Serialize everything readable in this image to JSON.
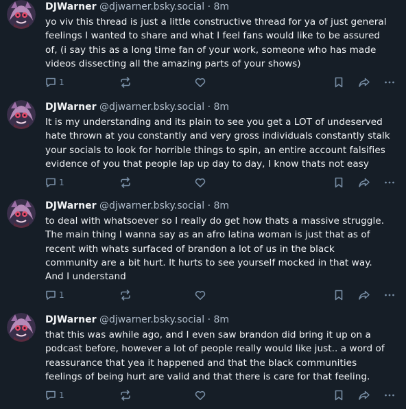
{
  "posts": [
    {
      "author_name": "DJWarner",
      "handle": "@djwarner.bsky.social",
      "time": "· 8m",
      "lines": [
        "yo viv this thread is just a little constructive thread for ya of just general",
        "feelings I wanted to share and what I feel fans would like to be assured",
        "of, (i say this as a long time fan of your work, someone who has made",
        "videos dissecting all the amazing parts of your shows)"
      ],
      "reply_count": "1"
    },
    {
      "author_name": "DJWarner",
      "handle": "@djwarner.bsky.social",
      "time": "· 8m",
      "lines": [
        "It is my understanding and its plain to see you get a LOT of undeserved",
        "hate thrown at you constantly and very gross individuals constantly stalk",
        "your socials to look for horrible things to spin, an entire account falsifies",
        "evidence of you that people lap up day to day, I know thats not easy"
      ],
      "reply_count": "1"
    },
    {
      "author_name": "DJWarner",
      "handle": "@djwarner.bsky.social",
      "time": "· 8m",
      "lines": [
        "to deal with whatsoever so I really do get how thats a massive struggle.",
        "The main thing I wanna say as an afro latina woman is just that as of",
        "recent with whats surfaced of brandon a lot of us in the black",
        "community are a bit hurt. It hurts to see yourself mocked in that way.",
        "And I understand"
      ],
      "reply_count": "1"
    },
    {
      "author_name": "DJWarner",
      "handle": "@djwarner.bsky.social",
      "time": "· 8m",
      "lines": [
        "that this was awhile ago, and I even saw brandon did bring it up on a",
        "podcast before, however a lot of people really would like just.. a word of",
        "reassurance that yea it happened and that the black communities",
        "feelings of being hurt are valid and that there is care for that feeling."
      ],
      "reply_count": "1"
    }
  ],
  "colors": {
    "background": "#161e27",
    "text": "#f1f3f5",
    "secondary": "#aebbc9",
    "icon": "#788ea5"
  },
  "icons": {
    "reply": "reply-icon",
    "repost": "repost-icon",
    "like": "heart-icon",
    "bookmark": "bookmark-icon",
    "share": "share-icon",
    "more": "more-icon"
  }
}
